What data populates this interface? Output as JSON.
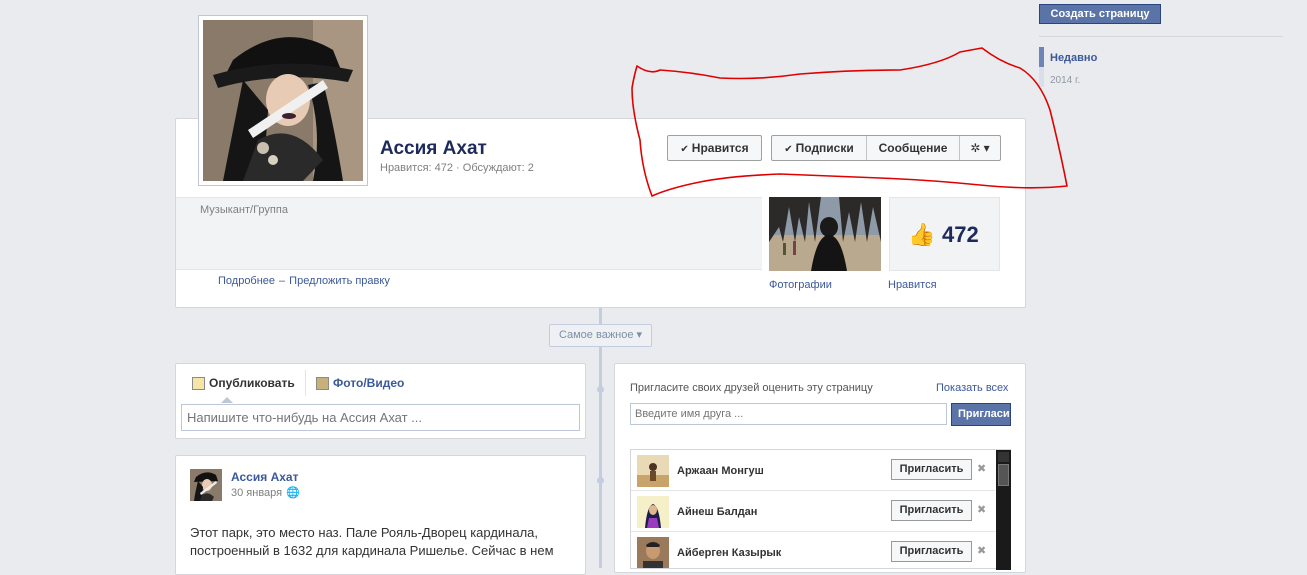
{
  "right_column": {
    "create_page_button": "Создать страницу",
    "recent": "Недавно",
    "year": "2014 г."
  },
  "header": {
    "page_name": "Ассия Ахат",
    "stats": "Нравится: 472 · Обсуждают: 2",
    "like_button": "Нравится",
    "following_button": "Подписки",
    "message_button": "Сообщение",
    "check_glyph": "✔",
    "gear_glyph": "✲ ▾",
    "category": "Музыкант/Группа",
    "more_link": "Подробнее",
    "dash": "–",
    "suggest_edit_link": "Предложить правку",
    "photos_label": "Фотографии",
    "likes_count": "472",
    "likes_label": "Нравится",
    "thumb_glyph": "👍"
  },
  "timeline": {
    "highlights_label": "Самое важное ▾"
  },
  "composer": {
    "publish_tab": "Опубликовать",
    "photo_video_tab": "Фото/Видео",
    "placeholder": "Напишите что-нибудь на Ассия Ахат ..."
  },
  "post": {
    "author": "Ассия Ахат",
    "date": "30 января",
    "globe_glyph": "🌐",
    "text": "Этот парк, это место наз. Пале Рояль-Дворец кардинала, построенный в 1632 для кардинала Ришелье. Сейчас в нем"
  },
  "invite": {
    "title": "Пригласите своих друзей оценить эту страницу",
    "show_all": "Показать всех",
    "input_placeholder": "Введите имя друга ...",
    "invite_button": "Пригласить",
    "remove_glyph": "✖",
    "friends": [
      {
        "name": "Аржаан Монгуш",
        "button": "Пригласить"
      },
      {
        "name": "Айнеш Балдан",
        "button": "Пригласить"
      },
      {
        "name": "Айберген Казырык",
        "button": "Пригласить"
      }
    ]
  },
  "colors": {
    "fb_blue": "#3b5998",
    "annotation_red": "#e00000"
  }
}
